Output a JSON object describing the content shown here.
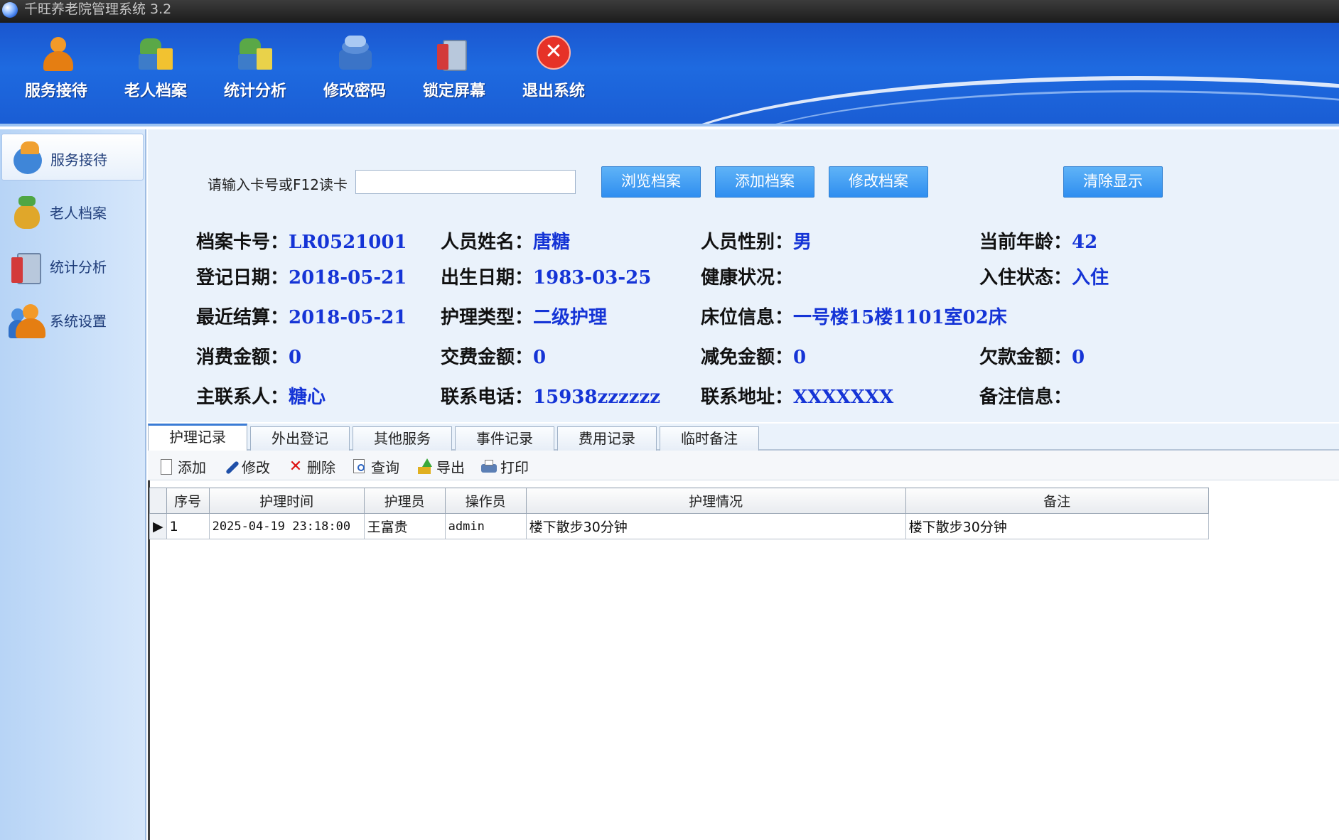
{
  "window": {
    "title": "千旺养老院管理系统 3.2"
  },
  "toolbar": {
    "items": [
      {
        "label": "服务接待",
        "icon": "reception-person-icon"
      },
      {
        "label": "老人档案",
        "icon": "elder-archive-icon"
      },
      {
        "label": "统计分析",
        "icon": "statistics-icon"
      },
      {
        "label": "修改密码",
        "icon": "change-password-icon"
      },
      {
        "label": "锁定屏幕",
        "icon": "lock-screen-icon"
      },
      {
        "label": "退出系统",
        "icon": "exit-icon"
      }
    ]
  },
  "sidebar": {
    "items": [
      {
        "label": "服务接待",
        "active": true
      },
      {
        "label": "老人档案",
        "active": false
      },
      {
        "label": "统计分析",
        "active": false
      },
      {
        "label": "系统设置",
        "active": false
      }
    ]
  },
  "search": {
    "label": "请输入卡号或F12读卡",
    "value": ""
  },
  "buttons": {
    "browse": "浏览档案",
    "add": "添加档案",
    "edit": "修改档案",
    "clear": "清除显示"
  },
  "profile": {
    "card_no": {
      "label": "档案卡号：",
      "value": "LR0521001"
    },
    "name": {
      "label": "人员姓名：",
      "value": "唐糖"
    },
    "gender": {
      "label": "人员性别：",
      "value": "男"
    },
    "age": {
      "label": "当前年龄：",
      "value": "42"
    },
    "reg_date": {
      "label": "登记日期：",
      "value": "2018-05-21"
    },
    "birth_date": {
      "label": "出生日期：",
      "value": "1983-03-25"
    },
    "health": {
      "label": "健康状况：",
      "value": ""
    },
    "stay_status": {
      "label": "入住状态：",
      "value": "入住"
    },
    "last_settle": {
      "label": "最近结算：",
      "value": "2018-05-21"
    },
    "care_type": {
      "label": "护理类型：",
      "value": "二级护理"
    },
    "bed": {
      "label": "床位信息：",
      "value": "一号楼15楼1101室02床"
    },
    "consume": {
      "label": "消费金额：",
      "value": "0"
    },
    "paid": {
      "label": "交费金额：",
      "value": "0"
    },
    "discount": {
      "label": "减免金额：",
      "value": "0"
    },
    "arrears": {
      "label": "欠款金额：",
      "value": "0"
    },
    "contact": {
      "label": "主联系人：",
      "value": "糖心"
    },
    "phone": {
      "label": "联系电话：",
      "value": "15938zzzzzz"
    },
    "address": {
      "label": "联系地址：",
      "value": "XXXXXXX"
    },
    "remark": {
      "label": "备注信息：",
      "value": ""
    }
  },
  "tabs": [
    {
      "label": "护理记录",
      "active": true
    },
    {
      "label": "外出登记",
      "active": false
    },
    {
      "label": "其他服务",
      "active": false
    },
    {
      "label": "事件记录",
      "active": false
    },
    {
      "label": "费用记录",
      "active": false
    },
    {
      "label": "临时备注",
      "active": false
    }
  ],
  "actions": {
    "add": "添加",
    "edit": "修改",
    "delete": "删除",
    "query": "查询",
    "export": "导出",
    "print": "打印"
  },
  "grid": {
    "columns": [
      "序号",
      "护理时间",
      "护理员",
      "操作员",
      "护理情况",
      "备注"
    ],
    "rows": [
      [
        "1",
        "2025-04-19 23:18:00",
        "王富贵",
        "admin",
        "楼下散步30分钟",
        "楼下散步30分钟"
      ]
    ]
  },
  "colors": {
    "toolbar_blue": "#1e6ae0",
    "value_blue": "#1534d6",
    "button_blue": "#2f8ef0"
  }
}
